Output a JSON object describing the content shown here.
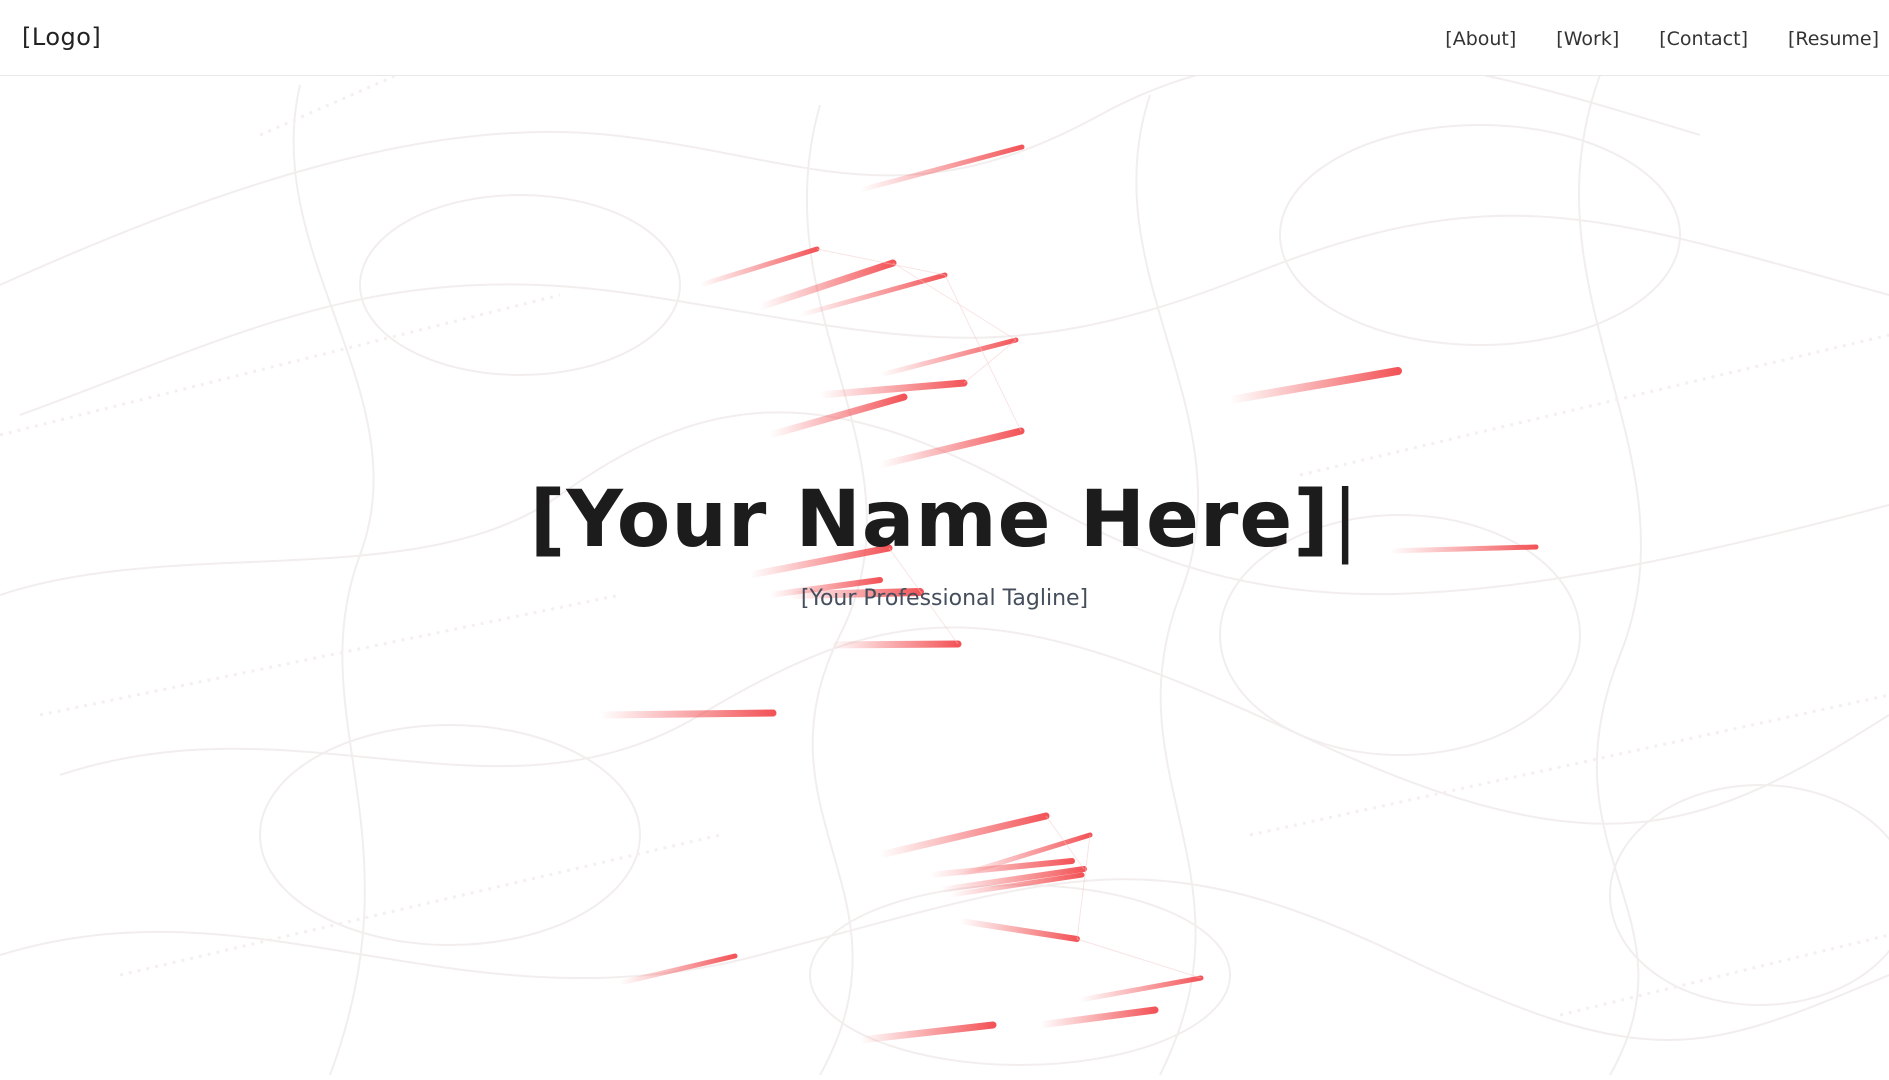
{
  "header": {
    "logo": "[Logo]",
    "nav": [
      {
        "label": "[About]"
      },
      {
        "label": "[Work]"
      },
      {
        "label": "[Contact]"
      },
      {
        "label": "[Resume]"
      }
    ]
  },
  "hero": {
    "title": "[Your Name Here]",
    "cursor": "|",
    "tagline": "[Your Professional Tagline]"
  },
  "background": {
    "accent_color": "#f24b4f",
    "scribble_color": "#f3eeee",
    "page_color": "#ffffff"
  }
}
